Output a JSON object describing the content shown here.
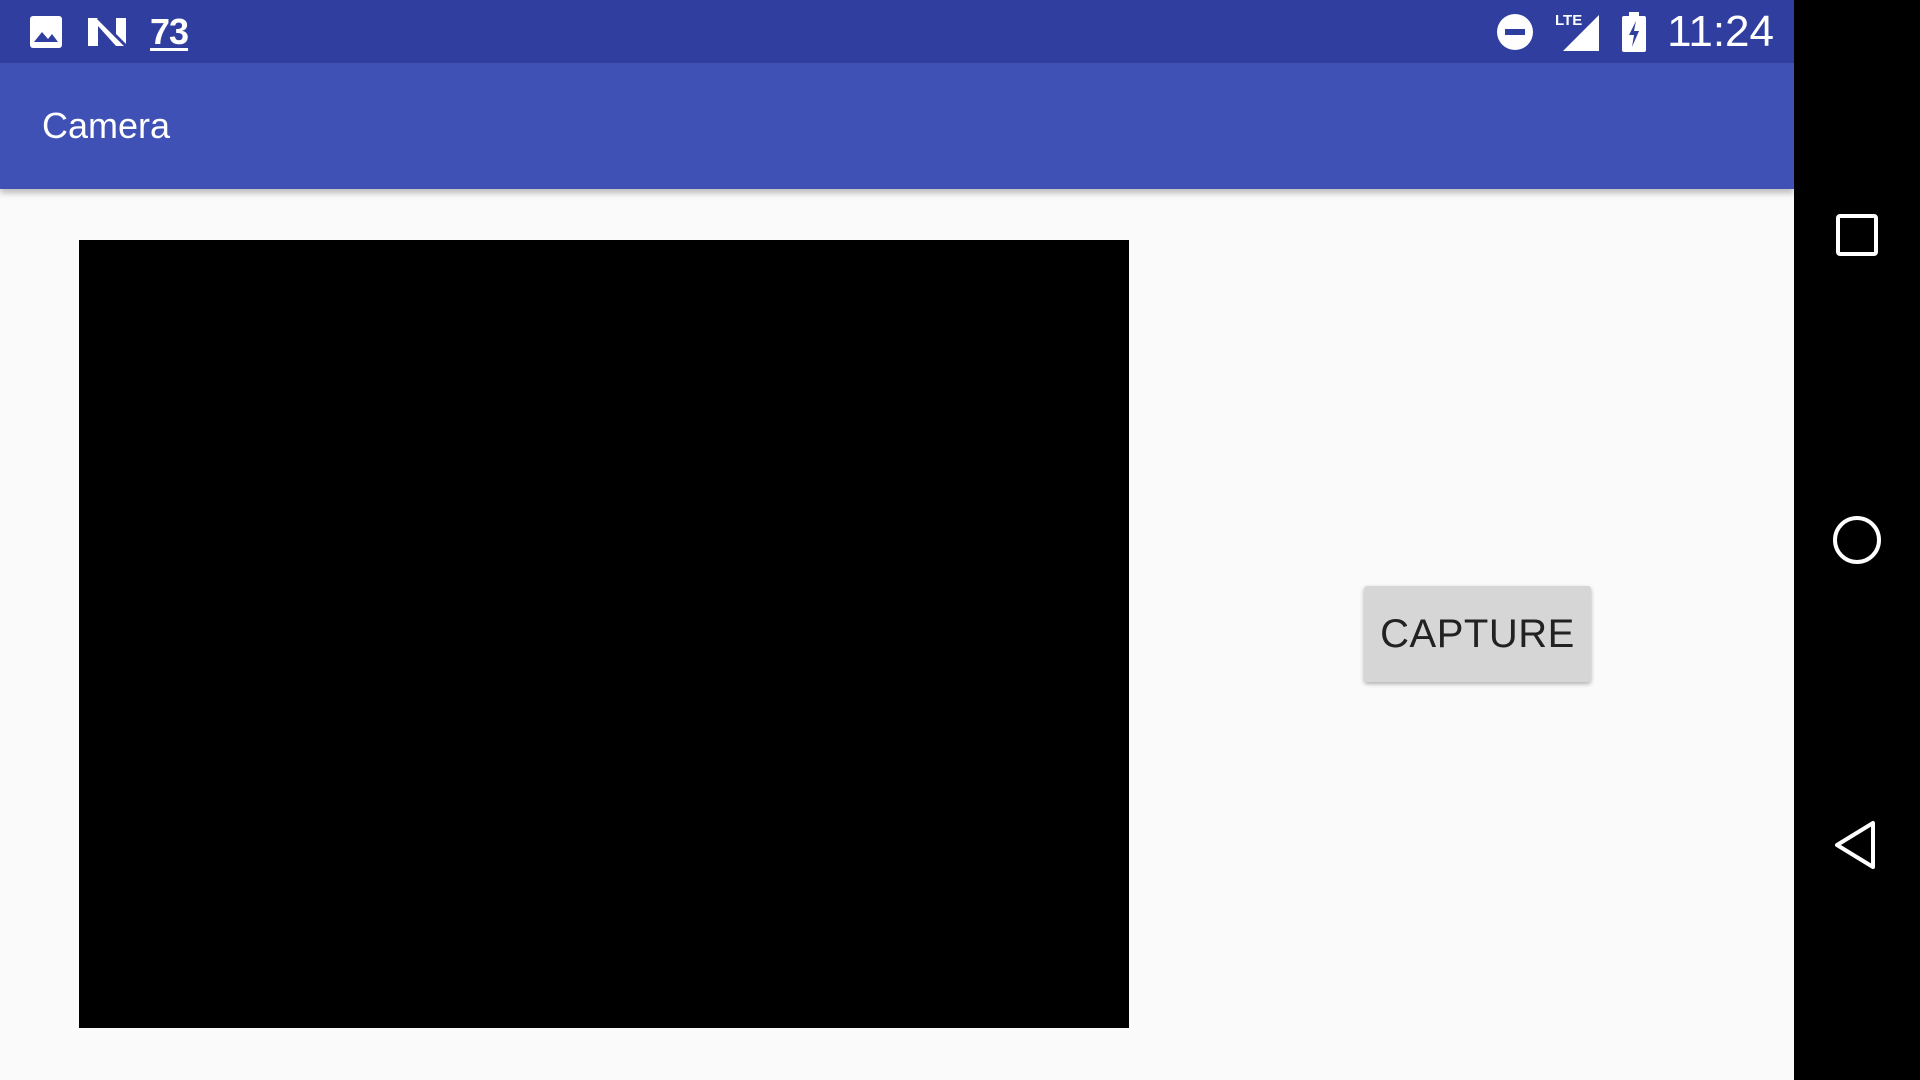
{
  "status_bar": {
    "left_icons": [
      "image-icon",
      "n-notification-icon"
    ],
    "temperature": "73",
    "right_icons": [
      "do-not-disturb-icon",
      "lte-signal-icon",
      "battery-charging-icon"
    ],
    "network_type": "LTE",
    "time": "11:24",
    "color": "#303f9f"
  },
  "app_bar": {
    "title": "Camera",
    "color": "#3f51b5"
  },
  "main": {
    "capture_button_label": "CAPTURE"
  },
  "nav_bar": {
    "buttons": [
      "recents-square-icon",
      "home-circle-icon",
      "back-triangle-icon"
    ]
  }
}
